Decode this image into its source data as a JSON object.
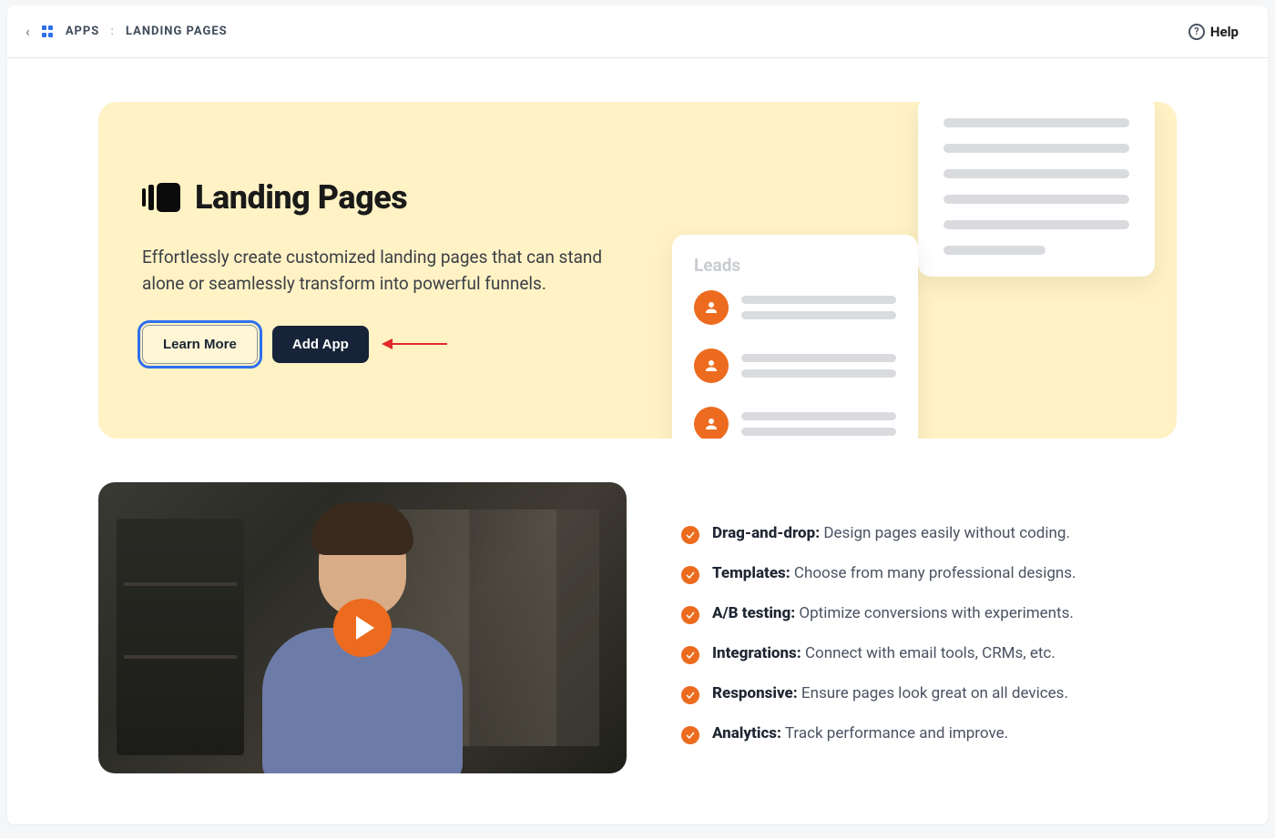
{
  "breadcrumb": {
    "apps_label": "APPS",
    "current": "LANDING PAGES"
  },
  "help_label": "Help",
  "hero": {
    "title": "Landing Pages",
    "description": "Effortlessly create customized landing pages that can stand alone or seamlessly transform into powerful funnels.",
    "learn_more_label": "Learn More",
    "add_app_label": "Add App",
    "leads_card_title": "Leads"
  },
  "features": [
    {
      "title": "Drag-and-drop:",
      "text": " Design pages easily without coding."
    },
    {
      "title": "Templates:",
      "text": " Choose from many professional designs."
    },
    {
      "title": "A/B testing:",
      "text": " Optimize conversions with experiments."
    },
    {
      "title": "Integrations:",
      "text": " Connect with email tools, CRMs, etc."
    },
    {
      "title": "Responsive:",
      "text": " Ensure pages look great on all devices."
    },
    {
      "title": "Analytics:",
      "text": " Track performance and improve."
    }
  ],
  "colors": {
    "accent_orange": "#ec6b1f",
    "hero_bg": "#fff2c5",
    "primary_dark": "#162338",
    "focus_blue": "#2f6fed",
    "annotation_red": "#e12a2a"
  }
}
